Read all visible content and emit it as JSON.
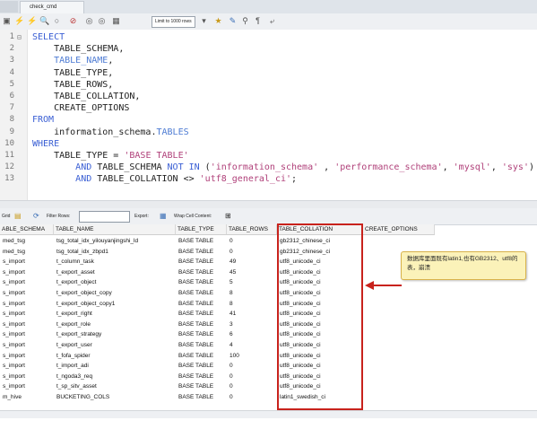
{
  "tab": {
    "title": "check_cmd"
  },
  "toolbar": {
    "limit_label": "Limit to 1000 rows"
  },
  "editor": {
    "lines": [
      {
        "no": "1",
        "fold": "⊟",
        "html": "<span class=\"kw\">SELECT</span>"
      },
      {
        "no": "2",
        "fold": "",
        "html": "    TABLE_SCHEMA,"
      },
      {
        "no": "3",
        "fold": "",
        "html": "    <span class=\"hl\">TABLE_NAME</span>,"
      },
      {
        "no": "4",
        "fold": "",
        "html": "    TABLE_TYPE,"
      },
      {
        "no": "5",
        "fold": "",
        "html": "    TABLE_ROWS,"
      },
      {
        "no": "6",
        "fold": "",
        "html": "    TABLE_COLLATION,"
      },
      {
        "no": "7",
        "fold": "",
        "html": "    CREATE_OPTIONS"
      },
      {
        "no": "8",
        "fold": "",
        "html": "<span class=\"kw\">FROM</span>"
      },
      {
        "no": "9",
        "fold": "",
        "html": "    information_schema.<span class=\"hl\">TABLES</span>"
      },
      {
        "no": "10",
        "fold": "",
        "html": "<span class=\"kw\">WHERE</span>"
      },
      {
        "no": "11",
        "fold": "",
        "html": "    TABLE_TYPE = <span class=\"str\">'BASE TABLE'</span>"
      },
      {
        "no": "12",
        "fold": "",
        "html": "        <span class=\"kw\">AND</span> TABLE_SCHEMA <span class=\"kw\">NOT IN</span> (<span class=\"str\">'information_schema'</span> , <span class=\"str\">'performance_schema'</span>, <span class=\"str\">'mysql'</span>, <span class=\"str\">'sys'</span>)"
      },
      {
        "no": "13",
        "fold": "",
        "html": "        <span class=\"kw\">AND</span> TABLE_COLLATION &lt;&gt; <span class=\"str\">'utf8_general_ci'</span>;"
      }
    ]
  },
  "gridbar": {
    "grid_label": "Grid",
    "filter_label": "Filter Rows:",
    "export_label": "Export:",
    "wrap_label": "Wrap Cell Content:"
  },
  "table": {
    "columns": [
      "ABLE_SCHEMA",
      "TABLE_NAME",
      "TABLE_TYPE",
      "TABLE_ROWS",
      "TABLE_COLLATION",
      "CREATE_OPTIONS"
    ],
    "rows": [
      [
        "med_tsg",
        "tsg_total_idx_yilouyanjingshi_ld",
        "BASE TABLE",
        "0",
        "gb2312_chinese_ci",
        ""
      ],
      [
        "med_tsg",
        "tsg_total_idx_zbpd1",
        "BASE TABLE",
        "0",
        "gb2312_chinese_ci",
        ""
      ],
      [
        "s_import",
        "t_column_task",
        "BASE TABLE",
        "49",
        "utf8_unicode_ci",
        ""
      ],
      [
        "s_import",
        "t_export_asset",
        "BASE TABLE",
        "45",
        "utf8_unicode_ci",
        ""
      ],
      [
        "s_import",
        "t_export_object",
        "BASE TABLE",
        "5",
        "utf8_unicode_ci",
        ""
      ],
      [
        "s_import",
        "t_export_object_copy",
        "BASE TABLE",
        "8",
        "utf8_unicode_ci",
        ""
      ],
      [
        "s_import",
        "t_export_object_copy1",
        "BASE TABLE",
        "8",
        "utf8_unicode_ci",
        ""
      ],
      [
        "s_import",
        "t_export_right",
        "BASE TABLE",
        "41",
        "utf8_unicode_ci",
        ""
      ],
      [
        "s_import",
        "t_export_role",
        "BASE TABLE",
        "3",
        "utf8_unicode_ci",
        ""
      ],
      [
        "s_import",
        "t_export_strategy",
        "BASE TABLE",
        "6",
        "utf8_unicode_ci",
        ""
      ],
      [
        "s_import",
        "t_export_user",
        "BASE TABLE",
        "4",
        "utf8_unicode_ci",
        ""
      ],
      [
        "s_import",
        "t_fofa_spider",
        "BASE TABLE",
        "100",
        "utf8_unicode_ci",
        ""
      ],
      [
        "s_import",
        "t_import_adi",
        "BASE TABLE",
        "0",
        "utf8_unicode_ci",
        ""
      ],
      [
        "s_import",
        "t_ngoda3_req",
        "BASE TABLE",
        "0",
        "utf8_unicode_ci",
        ""
      ],
      [
        "s_import",
        "t_sp_sitv_asset",
        "BASE TABLE",
        "0",
        "utf8_unicode_ci",
        ""
      ],
      [
        "m_hive",
        "BUCKETING_COLS",
        "BASE TABLE",
        "0",
        "latin1_swedish_ci",
        ""
      ]
    ]
  },
  "annotation": {
    "text": "数据库里面既有latin1,也有GB2312、utf8的表，崩溃",
    "border_color": "#c8221c",
    "note_color": "#fbf2b9"
  }
}
